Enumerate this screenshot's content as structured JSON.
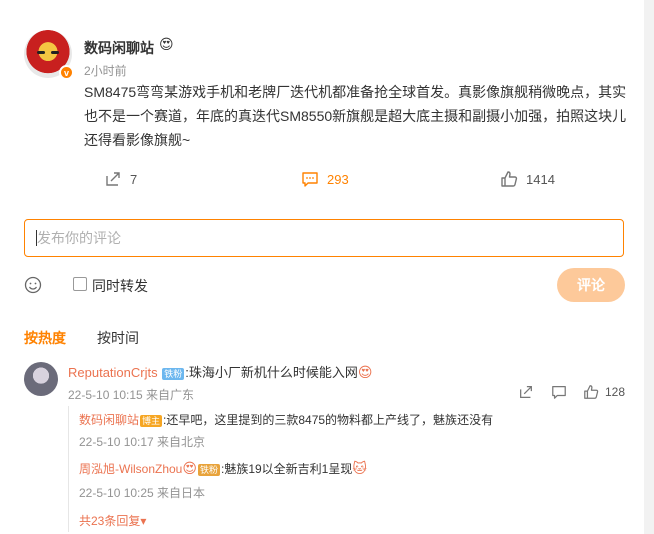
{
  "post": {
    "author": "数码闲聊站",
    "author_emoji": "😍",
    "verified_badge": "v",
    "time": "2小时前",
    "text": "SM8475弯弯某游戏手机和老牌厂迭代机都准备抢全球首发。真影像旗舰稍微晚点，其实也不是一个赛道，年底的真迭代SM8550新旗舰是超大底主摄和副摄小加强，拍照这块儿还得看影像旗舰~",
    "repost_count": "7",
    "comment_count": "293",
    "like_count": "1414"
  },
  "composer": {
    "placeholder": "发布你的评论",
    "repost_label": "同时转发",
    "submit_label": "评论"
  },
  "sort_tabs": {
    "hot": "按热度",
    "time": "按时间"
  },
  "comments": [
    {
      "user": "ReputationCrjts",
      "badge": "铁粉",
      "text": ":珠海小厂新机什么时候能入网",
      "emoji": "😍",
      "meta": "22-5-10 10:15 来自广东",
      "like_count": "128",
      "replies": [
        {
          "user": "数码闲聊站",
          "badge": "博主",
          "text": ":还早吧，这里提到的三款8475的物料都上产线了，魅族还没有",
          "meta": "22-5-10 10:17 来自北京"
        },
        {
          "user": "周泓旭-WilsonZhou",
          "user_emoji": "😍",
          "badge": "铁粉",
          "text": ":魅族19以全新吉利1呈现",
          "emoji": "🐱",
          "meta": "22-5-10 10:25 来自日本"
        }
      ],
      "more_replies": "共23条回复"
    }
  ],
  "colors": {
    "accent": "#ff8200",
    "username": "#eb7350",
    "muted": "#939393"
  }
}
